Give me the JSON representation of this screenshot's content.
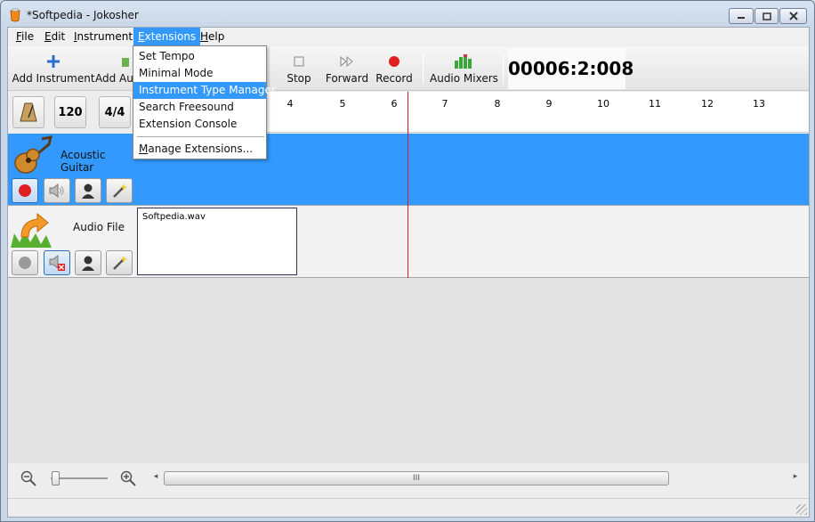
{
  "window": {
    "title": "*Softpedia - Jokosher"
  },
  "menubar": {
    "items": [
      {
        "label": "File",
        "u": "F",
        "rest": "ile"
      },
      {
        "label": "Edit",
        "u": "E",
        "rest": "dit"
      },
      {
        "label": "Instrument",
        "u": "I",
        "rest": "nstrument"
      },
      {
        "label": "Extensions",
        "u": "E",
        "rest": "xtensions"
      },
      {
        "label": "Help",
        "u": "H",
        "rest": "elp"
      }
    ]
  },
  "extensions_menu": {
    "items": [
      "Set Tempo",
      "Minimal Mode",
      "Instrument Type Manager",
      "Search Freesound",
      "Extension Console"
    ],
    "highlighted": "Instrument Type Manager",
    "manage": {
      "u": "M",
      "rest": "anage Extensions..."
    }
  },
  "toolbar": {
    "add_instrument": "Add Instrument",
    "add_audio": "Add Au",
    "stop": "Stop",
    "forward": "Forward",
    "record": "Record",
    "audio_mixers": "Audio Mixers",
    "timer": "00006:2:008"
  },
  "header": {
    "tempo": "120",
    "time_signature": "4/4",
    "ruler": [
      "4",
      "5",
      "6",
      "7",
      "8",
      "9",
      "10",
      "11",
      "12",
      "13"
    ]
  },
  "tracks": [
    {
      "name": "Acoustic Guitar"
    },
    {
      "name": "Audio File",
      "clip": "Softpedia.wav"
    }
  ],
  "scrollbar": {
    "grip": "III"
  },
  "colors": {
    "selected_track": "#3399ff",
    "highlight": "#3399ff",
    "playhead": "#cc2222"
  }
}
